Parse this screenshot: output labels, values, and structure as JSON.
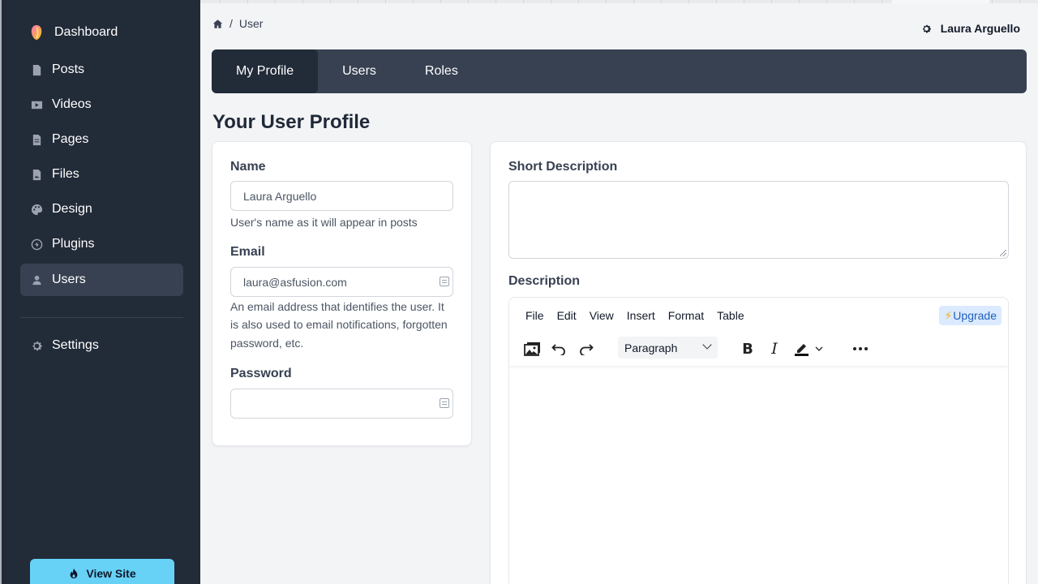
{
  "sidebar": {
    "brand": "Dashboard",
    "items": [
      {
        "label": "Posts",
        "icon": "file-icon"
      },
      {
        "label": "Videos",
        "icon": "video-icon"
      },
      {
        "label": "Pages",
        "icon": "page-icon"
      },
      {
        "label": "Files",
        "icon": "image-file-icon"
      },
      {
        "label": "Design",
        "icon": "palette-icon"
      },
      {
        "label": "Plugins",
        "icon": "plugin-icon"
      },
      {
        "label": "Users",
        "icon": "user-icon",
        "active": true
      }
    ],
    "settings": "Settings",
    "view_site": "View Site"
  },
  "header": {
    "breadcrumb_current": "User",
    "breadcrumb_sep": "/",
    "user_name": "Laura Arguello"
  },
  "tabs": [
    {
      "label": "My Profile",
      "active": true
    },
    {
      "label": "Users"
    },
    {
      "label": "Roles"
    }
  ],
  "page_title": "Your User Profile",
  "form": {
    "name_label": "Name",
    "name_value": "Laura Arguello",
    "name_help": "User's name as it will appear in posts",
    "email_label": "Email",
    "email_value": "laura@asfusion.com",
    "email_help_1": "An email address that identifies the user. It",
    "email_help_2": "is also used to email notifications, forgotten",
    "email_help_3": "password, etc.",
    "password_label": "Password",
    "password_value": "",
    "short_desc_label": "Short Description",
    "short_desc_value": "",
    "desc_label": "Description"
  },
  "editor": {
    "menu": [
      "File",
      "Edit",
      "View",
      "Insert",
      "Format",
      "Table"
    ],
    "upgrade": "Upgrade",
    "block_format": "Paragraph"
  },
  "colors": {
    "sidebar_bg": "#222b38",
    "tabbar_bg": "#374151",
    "view_site_bg": "#67d2f6",
    "upgrade_bg": "#dbeafe"
  }
}
